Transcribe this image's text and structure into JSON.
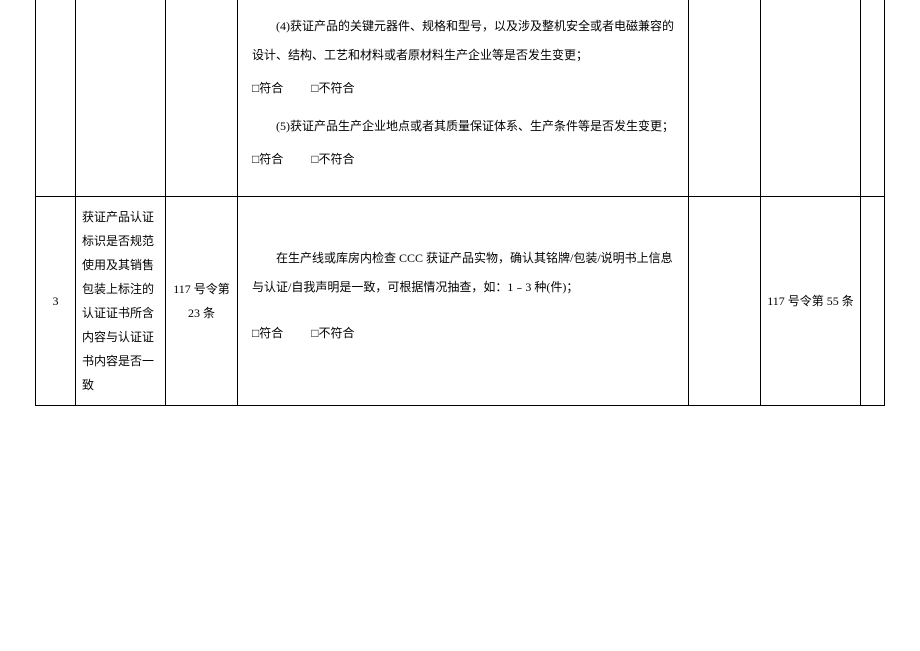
{
  "row1": {
    "content": {
      "item4_text": "(4)获证产品的关键元器件、规格和型号，以及涉及整机安全或者电磁兼容的设计、结构、工艺和材料或者原材料生产企业等是否发生变更；",
      "item4_check": "□符合",
      "item4_check2": "□不符合",
      "item5_text": "(5)获证产品生产企业地点或者其质量保证体系、生产条件等是否发生变更；",
      "item5_check": "□符合",
      "item5_check2": "□不符合"
    }
  },
  "row2": {
    "num": "3",
    "title": "获证产品认证标识是否规范使用及其销售包装上标注的认证证书所含内容与认证证书内容是否一致",
    "basis": "117 号令第 23 条",
    "content": {
      "p1": "在生产线或库房内检查 CCC 获证产品实物，确认其铭牌/包装/说明书上信息与认证/自我声明是一致，可根据情况抽查，如：1﹣3 种(件)；",
      "check1": "□符合",
      "check2": "□不符合"
    },
    "penalty": "117 号令第 55 条"
  }
}
